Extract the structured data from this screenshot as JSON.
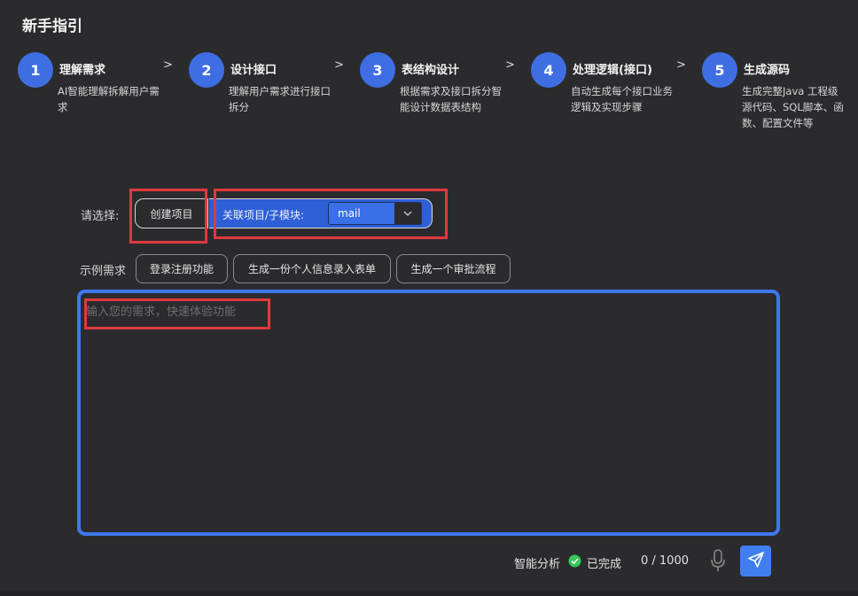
{
  "page_title": "新手指引",
  "steps": [
    {
      "num": "1",
      "title": "理解需求",
      "desc": "AI智能理解拆解用户需求"
    },
    {
      "num": "2",
      "title": "设计接口",
      "desc": "理解用户需求进行接口拆分"
    },
    {
      "num": "3",
      "title": "表结构设计",
      "desc": "根据需求及接口拆分智能设计数据表结构"
    },
    {
      "num": "4",
      "title": "处理逻辑(接口)",
      "desc": "自动生成每个接口业务逻辑及实现步骤"
    },
    {
      "num": "5",
      "title": "生成源码",
      "desc": "生成完整Java 工程级源代码、SQL脚本、函数、配置文件等"
    }
  ],
  "step_separator": ">",
  "select_label": "请选择:",
  "create_project_label": "创建项目",
  "associate": {
    "label": "关联项目/子模块:",
    "value": "mail"
  },
  "examples": {
    "label": "示例需求",
    "items": [
      "登录注册功能",
      "生成一份个人信息录入表单",
      "生成一个审批流程"
    ]
  },
  "input": {
    "placeholder": "输入您的需求，快速体验功能"
  },
  "footer": {
    "analysis_label": "智能分析",
    "status": "已完成",
    "counter": "0 / 1000"
  },
  "colors": {
    "accent": "#3f6ee3",
    "highlight": "#e0393e",
    "success": "#34c759"
  },
  "icons": [
    "chevron-down-icon",
    "check-circle-icon",
    "microphone-icon",
    "send-icon"
  ]
}
